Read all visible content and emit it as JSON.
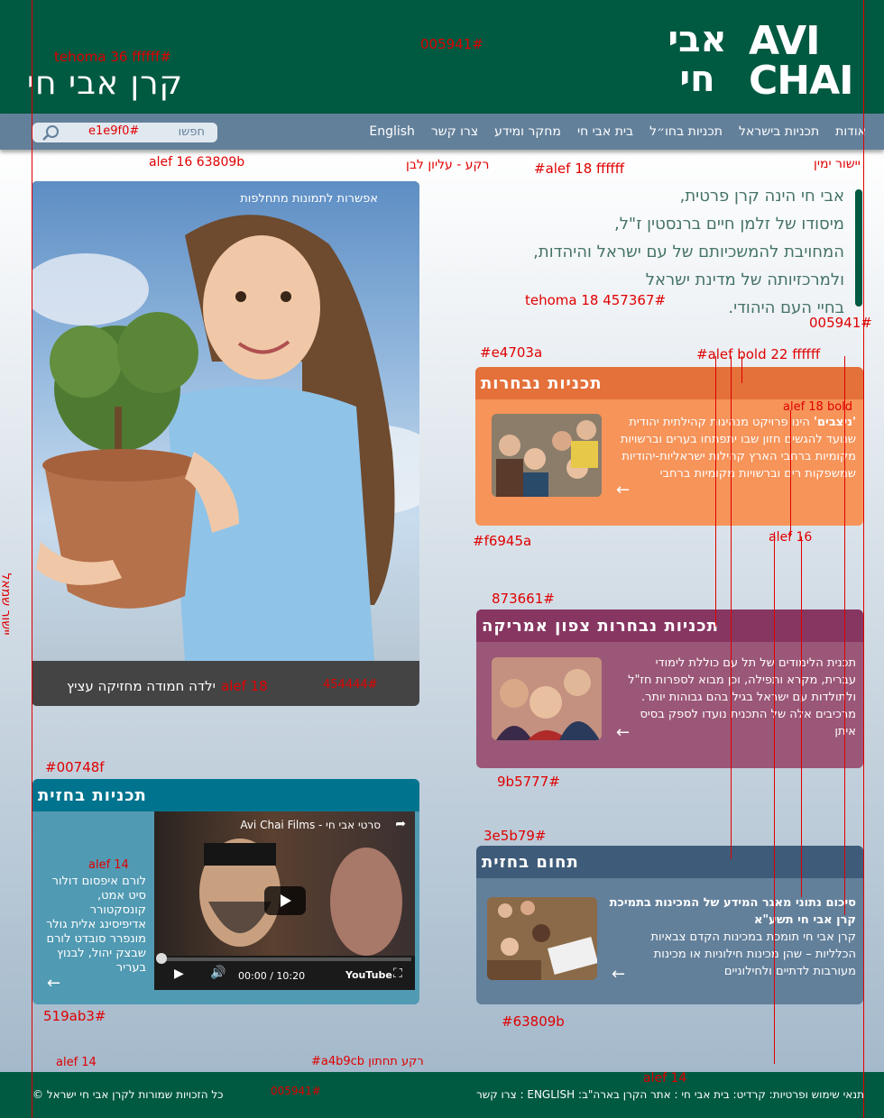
{
  "header": {
    "site_title": "קרן אבי חי",
    "logo_he": "אבי חי",
    "logo_en_top": "AVI",
    "logo_en_bottom": "CHAI"
  },
  "nav": {
    "items": [
      "אודות",
      "תכניות בישראל",
      "תכניות בחו״ל",
      "בית אבי חי",
      "מחקר ומידע",
      "צרו קשר",
      "English"
    ]
  },
  "search": {
    "placeholder": "חפשו"
  },
  "intro": {
    "lines": [
      "אבי חי הינה קרן פרטית,",
      "מיסודו של זלמן חיים ברנסטין ז\"ל,",
      "המחויבת להמשכיותם של עם ישראל והיהדות,",
      "ולמרכזיותה של מדינת ישראל",
      "בחיי העם היהודי."
    ]
  },
  "hero": {
    "options": "אפשרות לתמונות מתחלפות",
    "caption": "ילדה חמודה מחזיקה עציץ"
  },
  "panels": {
    "featured": {
      "title": "תכניות נבחרות",
      "bold": "'ניצבים'",
      "text": " הינו פרויקט מנהיגות קהילתית יהודית שנועד להגשים חזון שבו יתפתחו בערים וברשויות מקומיות ברחבי הארץ קהילות ישראליות-יהודיות שמשפקות רים וברשויות מקומיות ברחבי",
      "color_head": "#e4703a",
      "color_body": "#f6945a"
    },
    "north_america": {
      "title": "תכניות נבחרות צפון אמריקה",
      "text": "תכנית הלימודים של תל עם כוללת לימודי עברית, מקרא ותפילה, וכן מבוא לספרות חז\"ל ולתולדות עם ישראל בגיל בהם גבוהות יותר. מרכיבים אלה של התכנית נועדו לספק בסיס איתן",
      "color_head": "#873661",
      "color_body": "#9b5777"
    },
    "research": {
      "title": "תחום בחזית",
      "bold": "סיכום נתוני מאגר המידע של המכינות בתמיכת קרן אבי חי תשע\"א",
      "text": "קרן אבי חי תומכת במכינות הקדם צבאיות הכלליות – שהן מכינות חילוניות או מכינות מעורבות לדתיים ולחילוניים",
      "color_head": "#3e5b79",
      "color_body": "#63809b"
    },
    "spotlight": {
      "title": "תכניות בחזית",
      "text": "לורם איפסום דולור סיט אמט, קונסקטורר אדיפיסינג אלית גולר מונפרר סובדט לורם שבצק יהול, לבנוץ בעריר",
      "color_head": "#00748f",
      "color_body": "#519ab3",
      "video": {
        "title": "סרטי אבי חי - Avi Chai Films",
        "time": "00:00 / 10:20",
        "brand": "YouTube"
      }
    }
  },
  "footer": {
    "links": "תנאי שימוש ופרטיות: קרדיט: בית אבי חי : אתר הקרן בארה\"ב: ENGLISH : צרו קשר",
    "copyright": "כל הזכויות שמורות לקרן אבי חי ישראל ©"
  },
  "annotations": {
    "tehoma36": "tehoma 36 ffffff#",
    "header_color": "005941#",
    "alef16": "alef 16 63809b",
    "nav_bg": "רקע - עליון לבן",
    "alef18nav": "#alef 18 ffffff",
    "align_right": "יישור ימין",
    "tehoma18": "tehoma 18 457367#",
    "color_005941b": "005941#",
    "e4703a": "#e4703a",
    "alef_bold22": "#alef bold 22 ffffff",
    "alef18bold": "alef 18 bold",
    "f6945a": "#f6945a",
    "alef16b": "alef 16",
    "c873661": "873661#",
    "c9b5777": "9b5777#",
    "c3e5b79": "3e5b79#",
    "c63809b": "#63809b",
    "c00748f": "#00748f",
    "alef14a": "alef 14",
    "c519ab3": "519ab3#",
    "alef18cap": "alef 18",
    "c454444": "454444#",
    "align_left": "יישור שמאל",
    "alef14b": "alef 14",
    "bottom_bg": "#a4b9cb רקע תחתון",
    "alef14c": "alef 14",
    "c005941c": "005941#",
    "e1e9f0": "e1e9f0#"
  }
}
